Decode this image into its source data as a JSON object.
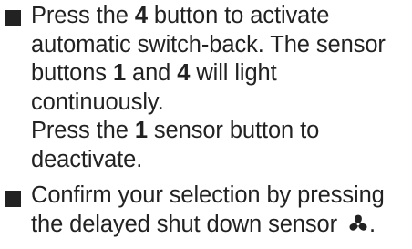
{
  "instructions": [
    {
      "activate_part1": "Press the ",
      "activate_button": "4",
      "activate_part2": " button to activate automatic switch-back. The sensor buttons ",
      "light_button_a": "1",
      "light_and": " and ",
      "light_button_b": "4",
      "light_part3": " will light continuously.",
      "deactivate_part1": "Press the ",
      "deactivate_button": "1",
      "deactivate_part2": " sensor button to deactivate."
    },
    {
      "confirm_text": "Confirm your selection by pressing the delayed shut down sensor ",
      "confirm_end": ".",
      "sensor_icon": "fan-icon"
    }
  ],
  "colors": {
    "text": "#222222",
    "background": "#ffffff"
  }
}
